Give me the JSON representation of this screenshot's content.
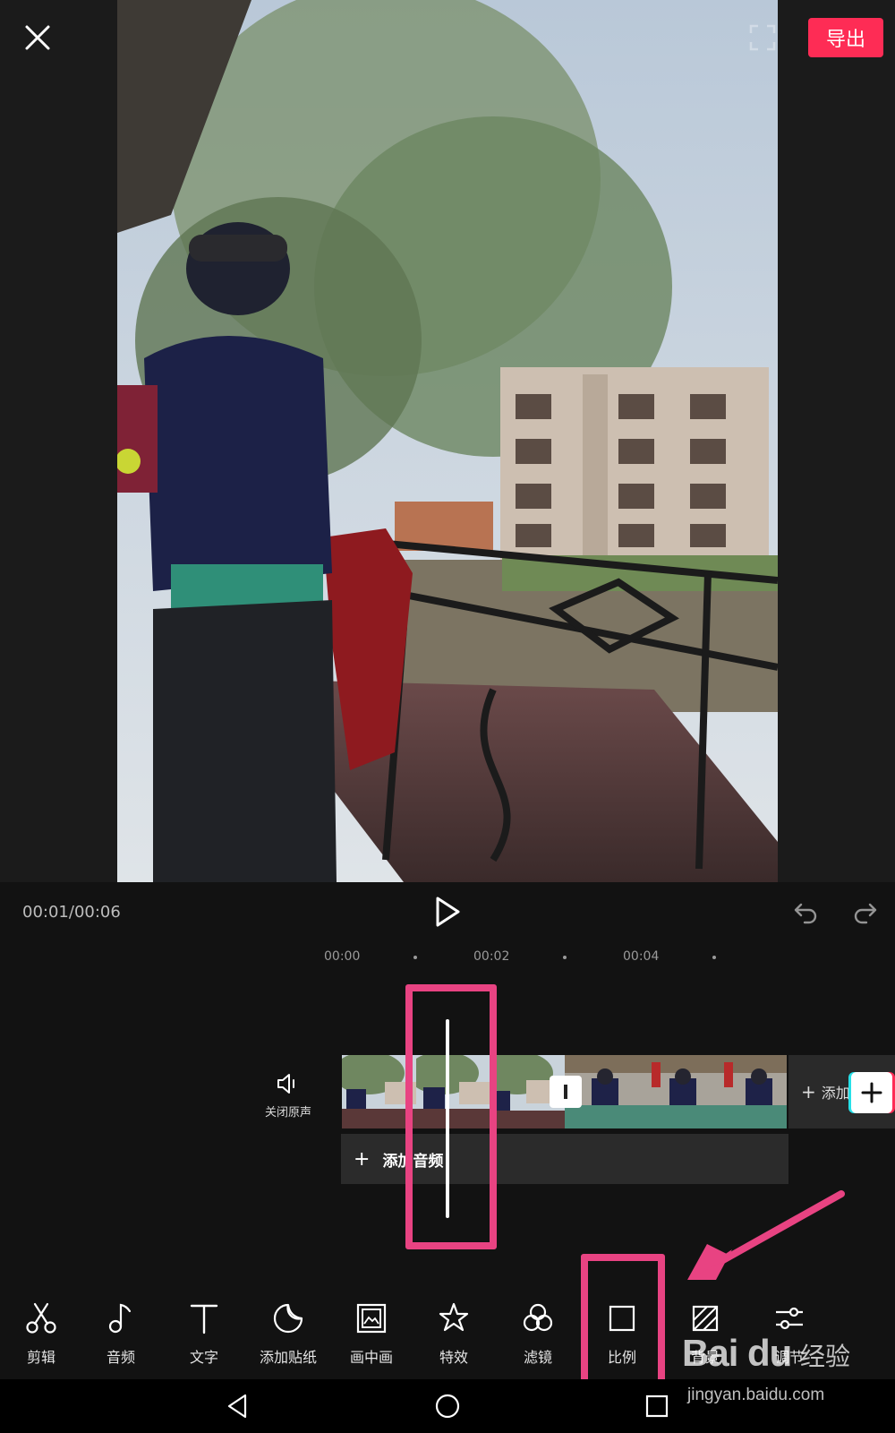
{
  "header": {
    "export_label": "导出"
  },
  "playback": {
    "time": "00:01/00:06"
  },
  "timeline": {
    "ruler": [
      "00:00",
      "00:02",
      "00:04"
    ],
    "mute_label": "关闭原声",
    "add_clip_label": "添加",
    "add_audio_label": "添加音频"
  },
  "toolbar": {
    "items": [
      {
        "label": "剪辑",
        "icon": "scissors-icon"
      },
      {
        "label": "音频",
        "icon": "music-note-icon"
      },
      {
        "label": "文字",
        "icon": "text-icon"
      },
      {
        "label": "添加贴纸",
        "icon": "sticker-icon"
      },
      {
        "label": "画中画",
        "icon": "picture-in-picture-icon"
      },
      {
        "label": "特效",
        "icon": "effects-star-icon"
      },
      {
        "label": "滤镜",
        "icon": "filter-icon"
      },
      {
        "label": "比例",
        "icon": "aspect-ratio-icon"
      },
      {
        "label": "背景",
        "icon": "background-icon"
      },
      {
        "label": "调节",
        "icon": "adjust-sliders-icon"
      }
    ]
  },
  "watermark": {
    "logo": "Bai du",
    "tag": "经验",
    "url": "jingyan.baidu.com"
  },
  "colors": {
    "accent": "#fe2c55",
    "highlight": "#e84382",
    "background": "#121212"
  }
}
